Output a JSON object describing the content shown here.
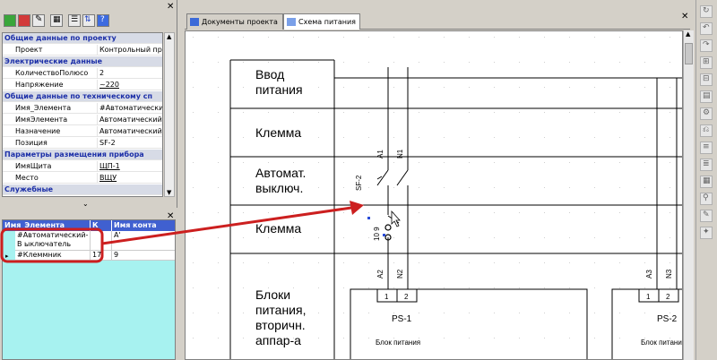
{
  "props": {
    "rows": [
      {
        "type": "cat",
        "label": "Общие данные по проекту"
      },
      {
        "type": "prop",
        "name": "Проект",
        "value": "Контрольный при"
      },
      {
        "type": "cat",
        "label": "Электрические данные"
      },
      {
        "type": "prop",
        "name": "КоличествоПолюсо",
        "value": "2"
      },
      {
        "type": "prop",
        "name": "Напряжение",
        "value": "~220",
        "underline": true
      },
      {
        "type": "cat",
        "label": "Общие данные по техническому сп"
      },
      {
        "type": "prop",
        "name": "Имя_Элемента",
        "value": "#Автоматический"
      },
      {
        "type": "prop",
        "name": "ИмяЭлемента",
        "value": "Автоматический_"
      },
      {
        "type": "prop",
        "name": "Назначение",
        "value": "Автоматический_"
      },
      {
        "type": "prop",
        "name": "Позиция",
        "value": "SF-2"
      },
      {
        "type": "cat",
        "label": "Параметры размещения прибора"
      },
      {
        "type": "prop",
        "name": "ИмяЩита",
        "value": "ЩП-1",
        "underline": true
      },
      {
        "type": "prop",
        "name": "Место",
        "value": "ВЩУ",
        "underline": true
      },
      {
        "type": "cat",
        "label": "Служебные"
      }
    ]
  },
  "table": {
    "headers": [
      "Имя_Элемента",
      "К",
      "Имя конта"
    ],
    "rows": [
      {
        "name": "#Автоматический-В ыключатель",
        "k": "",
        "contact": "A'"
      },
      {
        "name": "#Клеммник",
        "k": "17",
        "contact": "9"
      }
    ]
  },
  "tabs": [
    "Документы проекта",
    "Схема питания"
  ],
  "schematic": {
    "captions": [
      "Ввод питания",
      "Клемма",
      "Автомат. выключ.",
      "Клемма",
      "Блоки питания, вторичн. аппар-а"
    ],
    "labels": {
      "a1": "A1",
      "n1": "N1",
      "sf2": "SF-2",
      "term": "10 9",
      "a2": "A2",
      "n2": "N2",
      "a3": "A3",
      "n3": "N3",
      "ps1_pin1": "1",
      "ps1_pin2": "2",
      "ps1": "PS-1",
      "ps1_desc": "Блок питания",
      "ps2_pin1": "1",
      "ps2_pin2": "2",
      "ps2": "PS-2",
      "ps2_desc": "Блок питания"
    }
  },
  "colors": {
    "annotation": "#cc1f1f",
    "category": "#1c2fa8",
    "table_header": "#4060d0",
    "table_bg": "#a7f2f0"
  },
  "icons": [
    "add-icon",
    "delete-icon",
    "edit-icon",
    "table-icon",
    "list-icon",
    "sort-icon",
    "help-icon",
    "pin-icon",
    "close-icon"
  ]
}
